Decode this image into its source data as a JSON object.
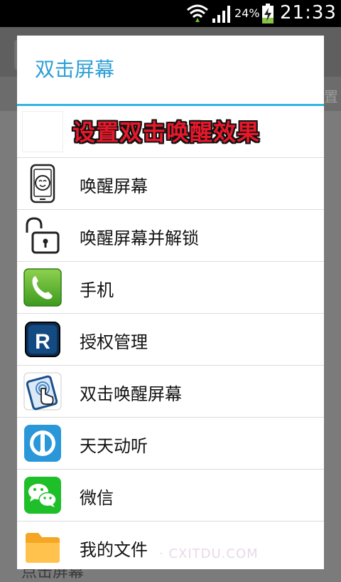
{
  "status_bar": {
    "battery_percent": "24%",
    "time": "21:33"
  },
  "background": {
    "bar_text": "置",
    "bottom_text": "点击屏幕"
  },
  "dialog": {
    "title": "双击屏幕",
    "banner_text": "设置双击唤醒效果",
    "items": [
      {
        "label": "唤醒屏幕",
        "icon": "phone-face-icon"
      },
      {
        "label": "唤醒屏幕并解锁",
        "icon": "unlock-icon"
      },
      {
        "label": "手机",
        "icon": "phone-app-icon"
      },
      {
        "label": "授权管理",
        "icon": "authorization-r-icon"
      },
      {
        "label": "双击唤醒屏幕",
        "icon": "double-tap-icon"
      },
      {
        "label": "天天动听",
        "icon": "music-player-icon"
      },
      {
        "label": "微信",
        "icon": "wechat-icon"
      },
      {
        "label": "我的文件",
        "icon": "folder-icon"
      }
    ]
  },
  "watermark": "· CXITDU.COM",
  "colors": {
    "accent": "#33b5e5",
    "title": "#2e9fd4",
    "banner_text": "#e8182b"
  }
}
